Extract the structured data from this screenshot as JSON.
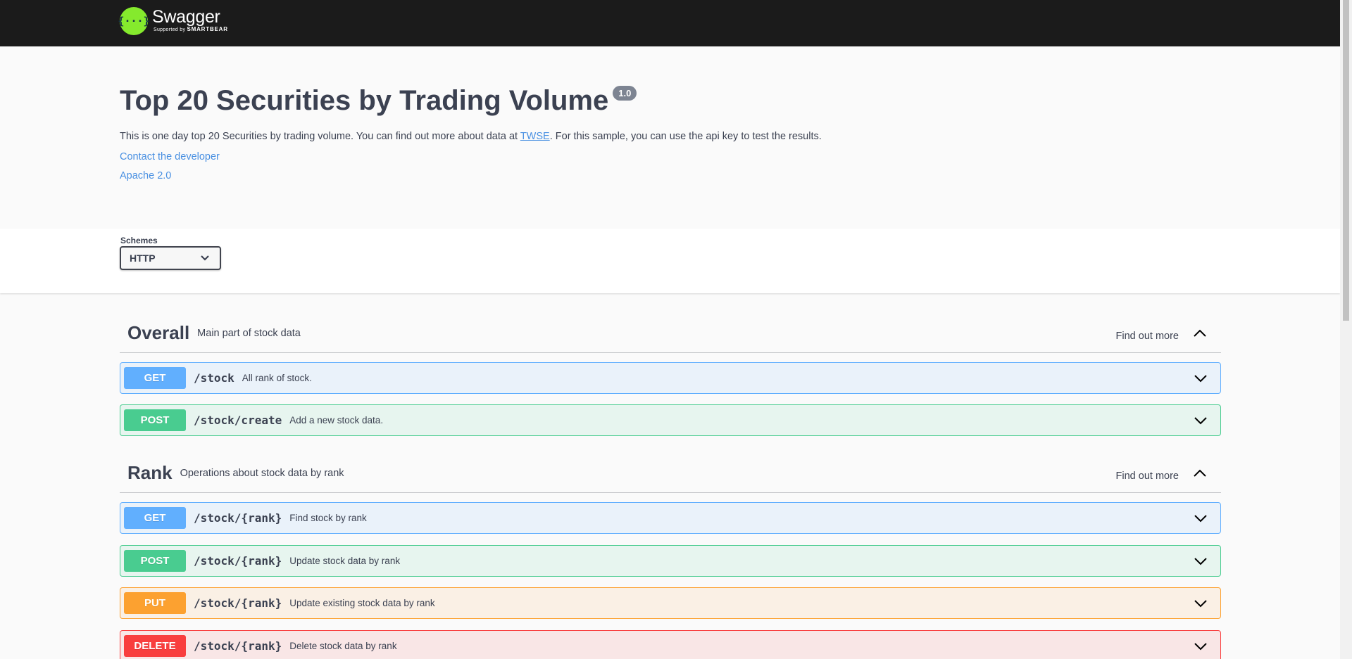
{
  "topbar": {
    "logo_glyph": "{···}",
    "logo_name": "Swagger",
    "logo_sub_prefix": "Supported by ",
    "logo_sub_brand": "SMARTBEAR"
  },
  "info": {
    "title": "Top 20 Securities by Trading Volume",
    "version": "1.0",
    "desc_before": "This is one day top 20 Securities by trading volume. You can find out more about data at ",
    "desc_link": "TWSE",
    "desc_after": ". For this sample, you can use the api key to test the results.",
    "contact": "Contact the developer",
    "license": "Apache 2.0"
  },
  "schemes": {
    "label": "Schemes",
    "selected": "HTTP"
  },
  "tags": [
    {
      "name": "Overall",
      "description": "Main part of stock data",
      "find_more": "Find out more",
      "operations": [
        {
          "method": "GET",
          "path": "/stock",
          "summary": "All rank of stock."
        },
        {
          "method": "POST",
          "path": "/stock/create",
          "summary": "Add a new stock data."
        }
      ]
    },
    {
      "name": "Rank",
      "description": "Operations about stock data by rank",
      "find_more": "Find out more",
      "operations": [
        {
          "method": "GET",
          "path": "/stock/{rank}",
          "summary": "Find stock by rank"
        },
        {
          "method": "POST",
          "path": "/stock/{rank}",
          "summary": "Update stock data by rank"
        },
        {
          "method": "PUT",
          "path": "/stock/{rank}",
          "summary": "Update existing stock data by rank"
        },
        {
          "method": "DELETE",
          "path": "/stock/{rank}",
          "summary": "Delete stock data by rank"
        }
      ]
    }
  ],
  "colors": {
    "get": "#61affe",
    "post": "#49cc90",
    "put": "#fca130",
    "delete": "#f93e3e",
    "topbar": "#1b1b1b",
    "logo": "#85ea2d"
  },
  "icons": {
    "expand": "chevron-down-icon",
    "collapse": "chevron-up-icon",
    "select": "chevron-down-icon"
  }
}
